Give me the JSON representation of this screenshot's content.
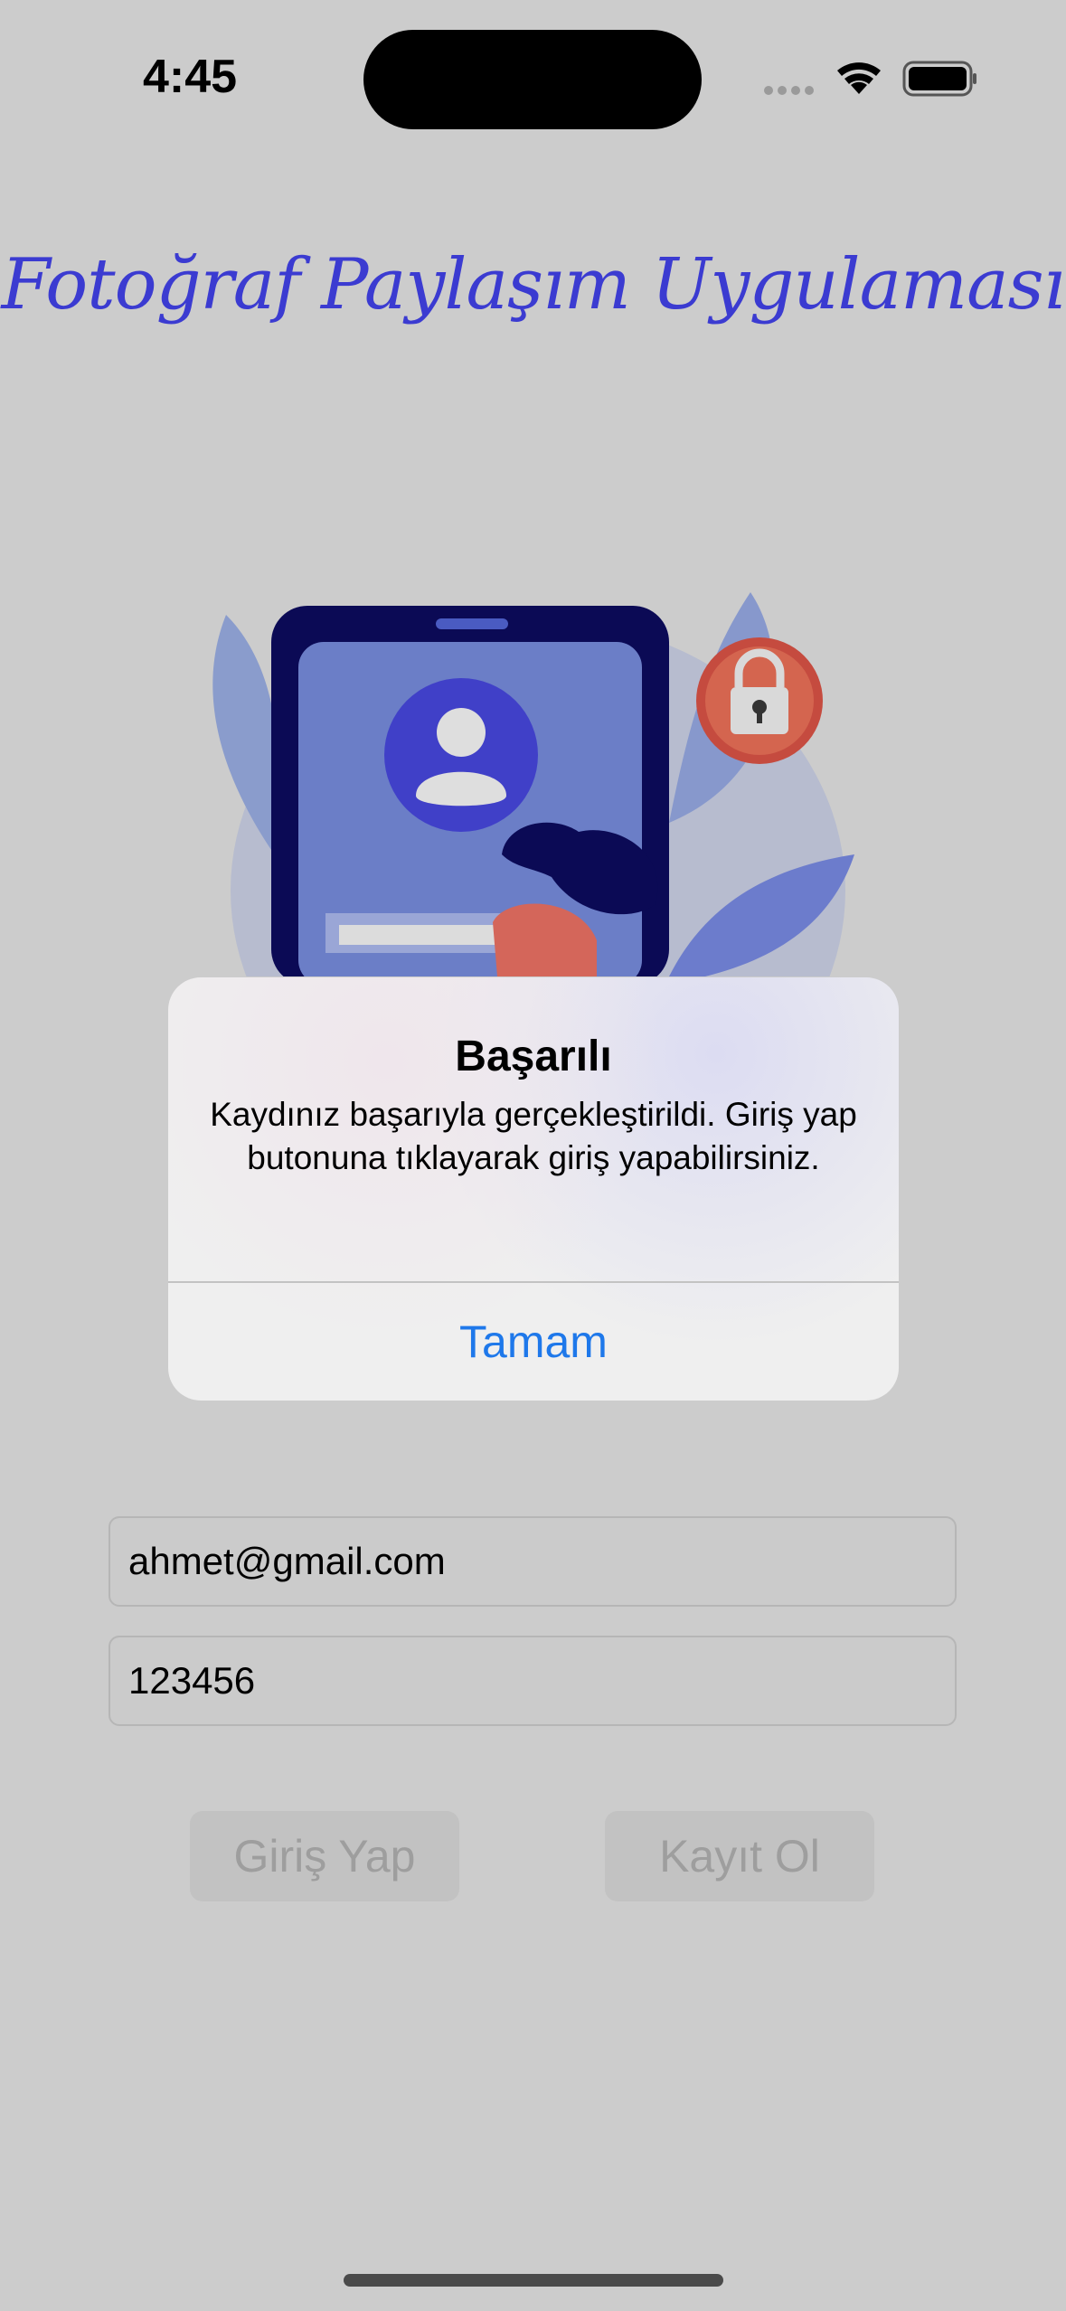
{
  "status_bar": {
    "time": "4:45"
  },
  "app": {
    "title": "Fotoğraf Paylaşım Uygulaması"
  },
  "alert": {
    "title": "Başarılı",
    "message": "Kaydınız başarıyla gerçekleştirildi. Giriş yap butonuna tıklayarak giriş yapabilirsiniz.",
    "button_label": "Tamam"
  },
  "form": {
    "email_value": "ahmet@gmail.com",
    "password_value": "123456",
    "login_label": "Giriş Yap",
    "register_label": "Kayıt Ol"
  },
  "colors": {
    "title": "#3b3bd1",
    "alert_button": "#1e78ea",
    "background": "#cccccc"
  }
}
